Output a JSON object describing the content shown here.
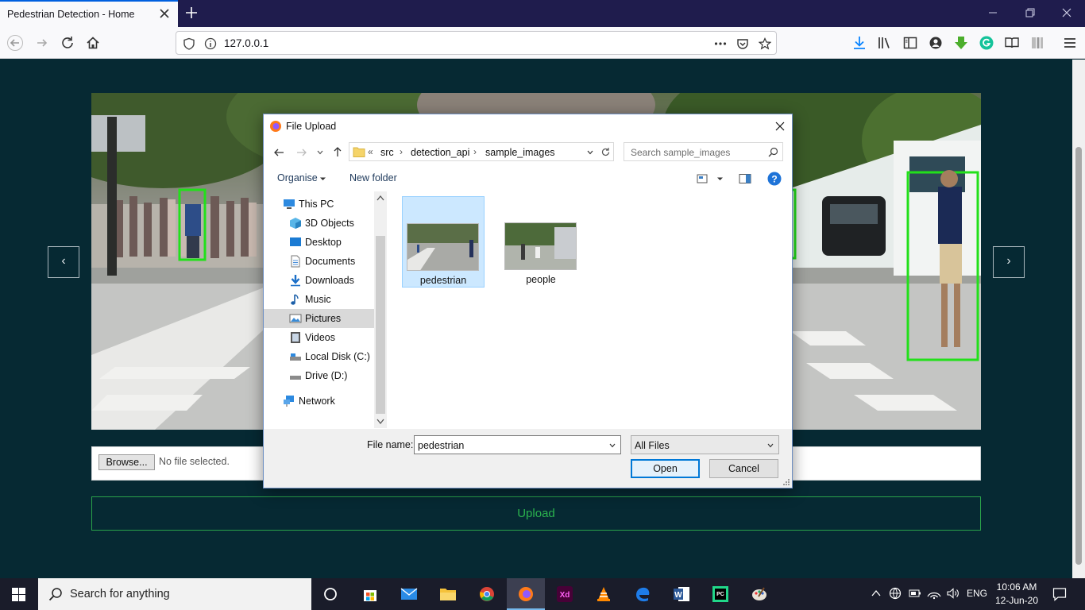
{
  "browser": {
    "tab_title": "Pedestrian Detection - Home",
    "url": "127.0.0.1"
  },
  "page": {
    "browse_label": "Browse...",
    "no_file_text": "No file selected.",
    "upload_label": "Upload",
    "prev_label": "‹",
    "next_label": "›"
  },
  "dialog": {
    "title": "File Upload",
    "breadcrumb_prefix": "«",
    "breadcrumb": [
      "src",
      "detection_api",
      "sample_images"
    ],
    "search_placeholder": "Search sample_images",
    "organise_label": "Organise",
    "new_folder_label": "New folder",
    "tree": [
      {
        "label": "This PC",
        "icon": "pc-icon"
      },
      {
        "label": "3D Objects",
        "icon": "cube-icon"
      },
      {
        "label": "Desktop",
        "icon": "desktop-icon"
      },
      {
        "label": "Documents",
        "icon": "document-icon"
      },
      {
        "label": "Downloads",
        "icon": "download-icon"
      },
      {
        "label": "Music",
        "icon": "music-icon"
      },
      {
        "label": "Pictures",
        "icon": "pictures-icon",
        "selected": true
      },
      {
        "label": "Videos",
        "icon": "video-icon"
      },
      {
        "label": "Local Disk (C:)",
        "icon": "disk-icon"
      },
      {
        "label": "Drive (D:)",
        "icon": "drive-icon"
      },
      {
        "label": "Network",
        "icon": "network-icon"
      }
    ],
    "files": [
      {
        "name": "pedestrian",
        "selected": true
      },
      {
        "name": "people",
        "selected": false
      }
    ],
    "file_name_label": "File name:",
    "file_name_value": "pedestrian",
    "file_type_value": "All Files",
    "open_label": "Open",
    "cancel_label": "Cancel"
  },
  "taskbar": {
    "search_placeholder": "Search for anything",
    "language": "ENG",
    "time": "10:06 AM",
    "date": "12-Jun-20"
  },
  "colors": {
    "page_background": "#062933",
    "upload_accent": "#2bb34e",
    "detection_box": "#22e01a",
    "dialog_selection": "#cce8ff"
  }
}
